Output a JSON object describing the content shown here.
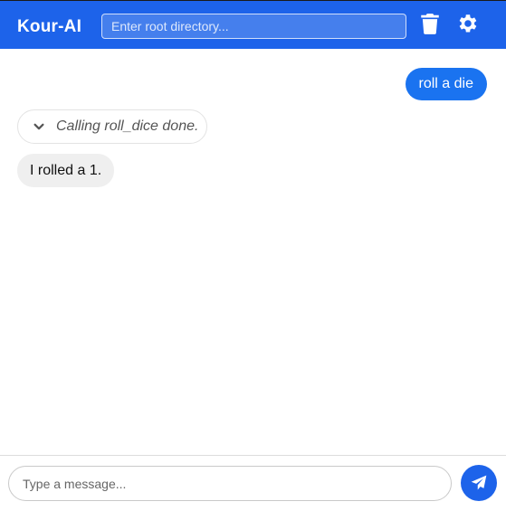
{
  "header": {
    "title": "Kour-AI",
    "root_placeholder": "Enter root directory...",
    "trash_icon": "trash-icon",
    "settings_icon": "gear-icon"
  },
  "chat": {
    "messages": [
      {
        "role": "user",
        "text": "roll a die"
      },
      {
        "role": "tool",
        "text": "Calling roll_dice done.",
        "icon": "chevron-down-icon"
      },
      {
        "role": "assistant",
        "text": "I rolled a 1."
      }
    ]
  },
  "composer": {
    "placeholder": "Type a message...",
    "send_icon": "paper-plane-icon"
  },
  "colors": {
    "accent": "#1d63ea",
    "user_bubble": "#1a73f0",
    "assistant_bubble": "#efefef"
  }
}
